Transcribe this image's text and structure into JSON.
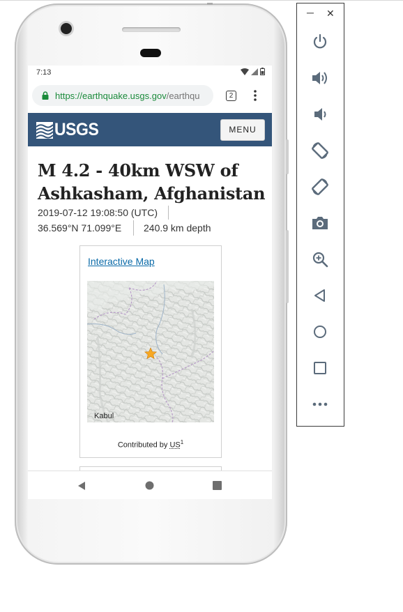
{
  "status_bar": {
    "time": "7:13"
  },
  "browser": {
    "url_host": "https://earthquake.usgs.gov",
    "url_path": "/earthqu",
    "tab_count": "2"
  },
  "site_header": {
    "logo_text": "USGS",
    "menu_label": "MENU"
  },
  "event": {
    "title": "M 4.2 - 40km WSW of Ashkasham, Afghanistan",
    "datetime": "2019-07-12 19:08:50 (UTC)",
    "coordinates": "36.569°N 71.099°E",
    "depth": "240.9 km depth"
  },
  "map_card": {
    "link_label": "Interactive Map",
    "map_place_label": "Kabul",
    "contributed_prefix": "Contributed by ",
    "contributed_by": "US",
    "contributed_sup": "1"
  },
  "colors": {
    "usgs_header": "#34557a",
    "link": "#0a6aa8",
    "url_secure": "#1a8a3a",
    "epicenter_star": "#f7a823"
  },
  "icons": {
    "status": [
      "wifi-icon",
      "signal-icon",
      "battery-icon"
    ],
    "nav": [
      "back-icon",
      "home-icon",
      "recents-icon"
    ],
    "emulator_panel": [
      "power-icon",
      "volume-up-icon",
      "volume-down-icon",
      "rotate-left-icon",
      "rotate-right-icon",
      "camera-icon",
      "zoom-icon",
      "back-icon",
      "home-icon",
      "overview-icon",
      "more-icon"
    ]
  }
}
